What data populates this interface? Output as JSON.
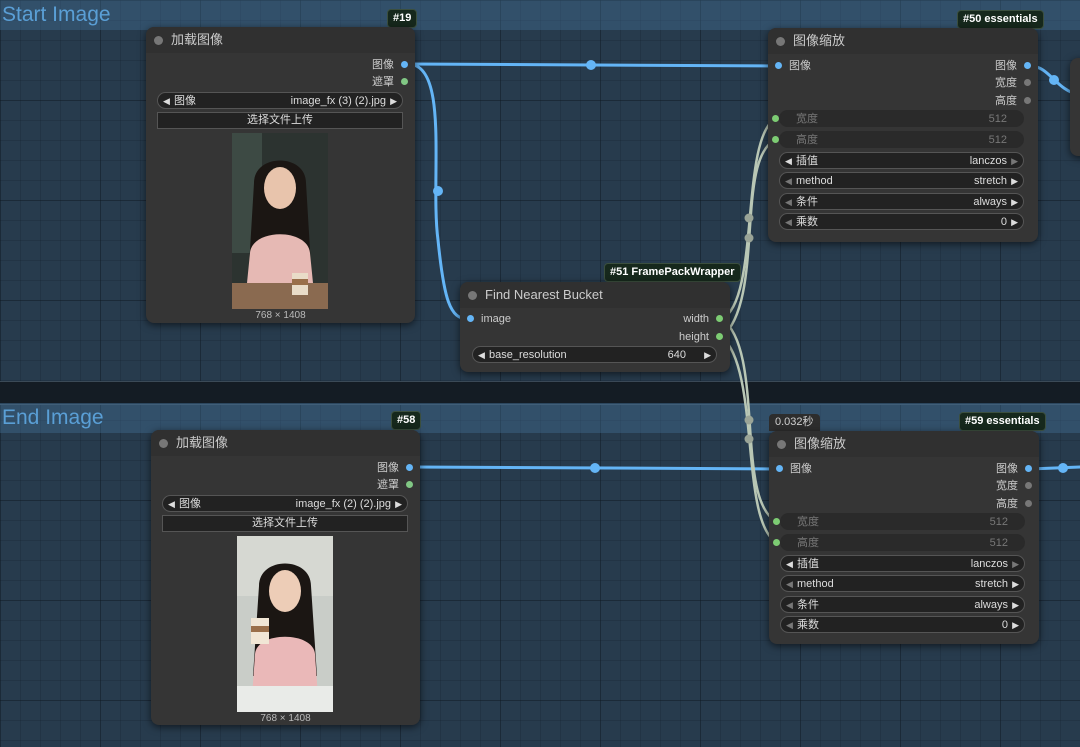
{
  "groups": [
    {
      "title": "Start Image"
    },
    {
      "title": "End Image"
    }
  ],
  "nodes": {
    "n19": {
      "badge": "#19",
      "title": "加载图像",
      "outputs": [
        "图像",
        "遮罩"
      ],
      "widget_label": "图像",
      "widget_value": "image_fx (3) (2).jpg",
      "upload_label": "选择文件上传",
      "image_size": "768 × 1408"
    },
    "n50": {
      "badge": "#50 essentials",
      "title": "图像缩放",
      "input": "图像",
      "outputs": [
        "图像",
        "宽度",
        "高度"
      ],
      "widgets": [
        {
          "label": "宽度",
          "value": "512"
        },
        {
          "label": "高度",
          "value": "512"
        },
        {
          "label": "插值",
          "value": "lanczos"
        },
        {
          "label": "method",
          "value": "stretch"
        },
        {
          "label": "条件",
          "value": "always"
        },
        {
          "label": "乘数",
          "value": "0"
        }
      ]
    },
    "n51": {
      "badge": "#51 FramePackWrapper",
      "title": "Find Nearest Bucket",
      "input": "image",
      "outputs": [
        "width",
        "height"
      ],
      "widget_label": "base_resolution",
      "widget_value": "640"
    },
    "n58": {
      "badge": "#58",
      "title": "加载图像",
      "outputs": [
        "图像",
        "遮罩"
      ],
      "widget_label": "图像",
      "widget_value": "image_fx (2) (2).jpg",
      "upload_label": "选择文件上传",
      "image_size": "768 × 1408"
    },
    "n59": {
      "badge": "#59 essentials",
      "timing": "0.032秒",
      "title": "图像缩放",
      "input": "图像",
      "outputs": [
        "图像",
        "宽度",
        "高度"
      ],
      "widgets": [
        {
          "label": "宽度",
          "value": "512"
        },
        {
          "label": "高度",
          "value": "512"
        },
        {
          "label": "插值",
          "value": "lanczos"
        },
        {
          "label": "method",
          "value": "stretch"
        },
        {
          "label": "条件",
          "value": "always"
        },
        {
          "label": "乘数",
          "value": "0"
        }
      ]
    }
  },
  "colors": {
    "image_link": "#64b5f6",
    "int_link": "#b9c7b5",
    "mask_port": "#81c784",
    "group_title": "#5a9fd6"
  }
}
